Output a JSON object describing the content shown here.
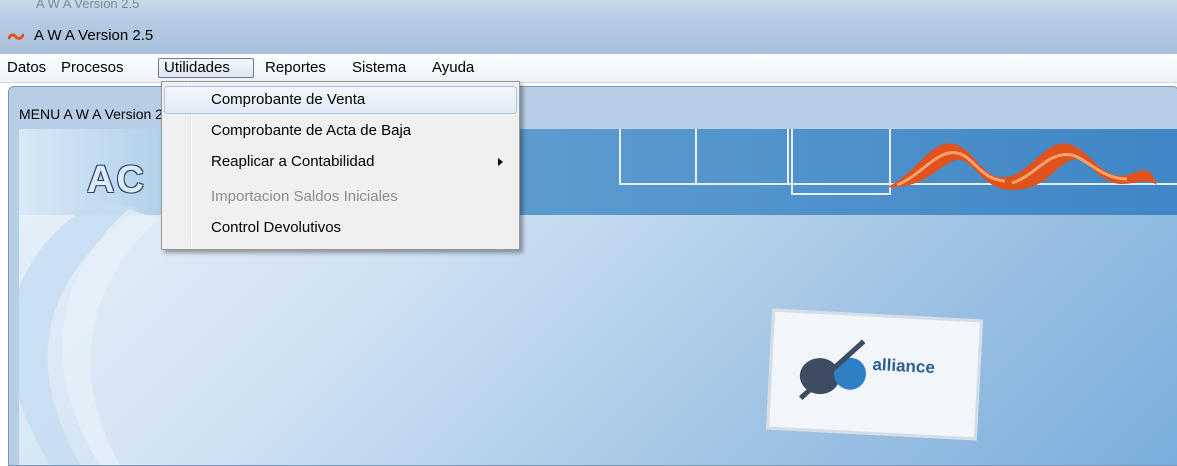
{
  "window": {
    "title": "A W A Version 2.5",
    "title_ghost": "A W A Version 2.5"
  },
  "menubar": {
    "items": [
      {
        "label": "Datos"
      },
      {
        "label": "Procesos"
      },
      {
        "label": "Utilidades",
        "open": true
      },
      {
        "label": "Reportes"
      },
      {
        "label": "Sistema"
      },
      {
        "label": "Ayuda"
      }
    ]
  },
  "dropdown": {
    "items": [
      {
        "label": "Comprobante de Venta",
        "state": "highlighted"
      },
      {
        "label": "Comprobante de Acta de Baja",
        "state": "normal"
      },
      {
        "label": "Reaplicar a Contabilidad",
        "state": "normal",
        "submenu": true
      },
      {
        "label": "Importacion Saldos Iniciales",
        "state": "disabled"
      },
      {
        "label": "Control Devolutivos",
        "state": "normal"
      }
    ]
  },
  "child_window": {
    "title": "MENU A W A Version 2.5"
  },
  "background": {
    "banner_logo_text": "AC",
    "sign_text": "alliance"
  },
  "colors": {
    "titlebar": "#b4c9e2",
    "menu_highlight_border": "#a8c4e6",
    "disabled_text": "#8d8d8d",
    "banner_blue": "#3f86c6",
    "logo_orange": "#e0531f"
  },
  "icons": {
    "app": "awa-app-icon",
    "submenu": "submenu-arrow-icon"
  }
}
